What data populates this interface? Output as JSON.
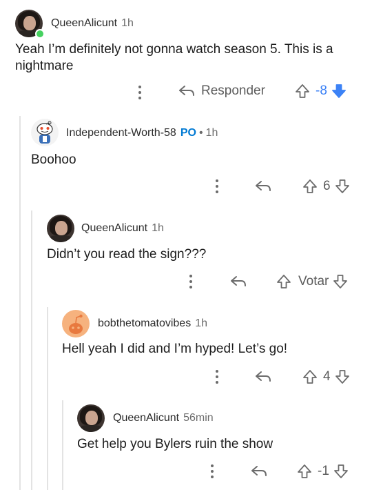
{
  "comments": [
    {
      "user": "QueenAlicunt",
      "time": "1h",
      "text": "Yeah I’m definitely not gonna watch season 5. This is a nightmare",
      "reply_label": "Responder",
      "score": "-8",
      "vote": "down"
    },
    {
      "user": "Independent-Worth-58",
      "op": "PO",
      "sep": "•",
      "time": "1h",
      "text": "Boohoo",
      "score": "6"
    },
    {
      "user": "QueenAlicunt",
      "time": "1h",
      "text": "Didn’t you read the sign???",
      "score": "Votar"
    },
    {
      "user": "bobthetomatovibes",
      "time": "1h",
      "text": "Hell yeah I did and I’m hyped! Let’s go!",
      "score": "4"
    },
    {
      "user": "QueenAlicunt",
      "time": "56min",
      "text": "Get help you Bylers ruin the show",
      "score": "-1"
    }
  ],
  "colors": {
    "downvote_active": "#3c82f6",
    "op": "#0079d3",
    "online": "#46d160"
  }
}
